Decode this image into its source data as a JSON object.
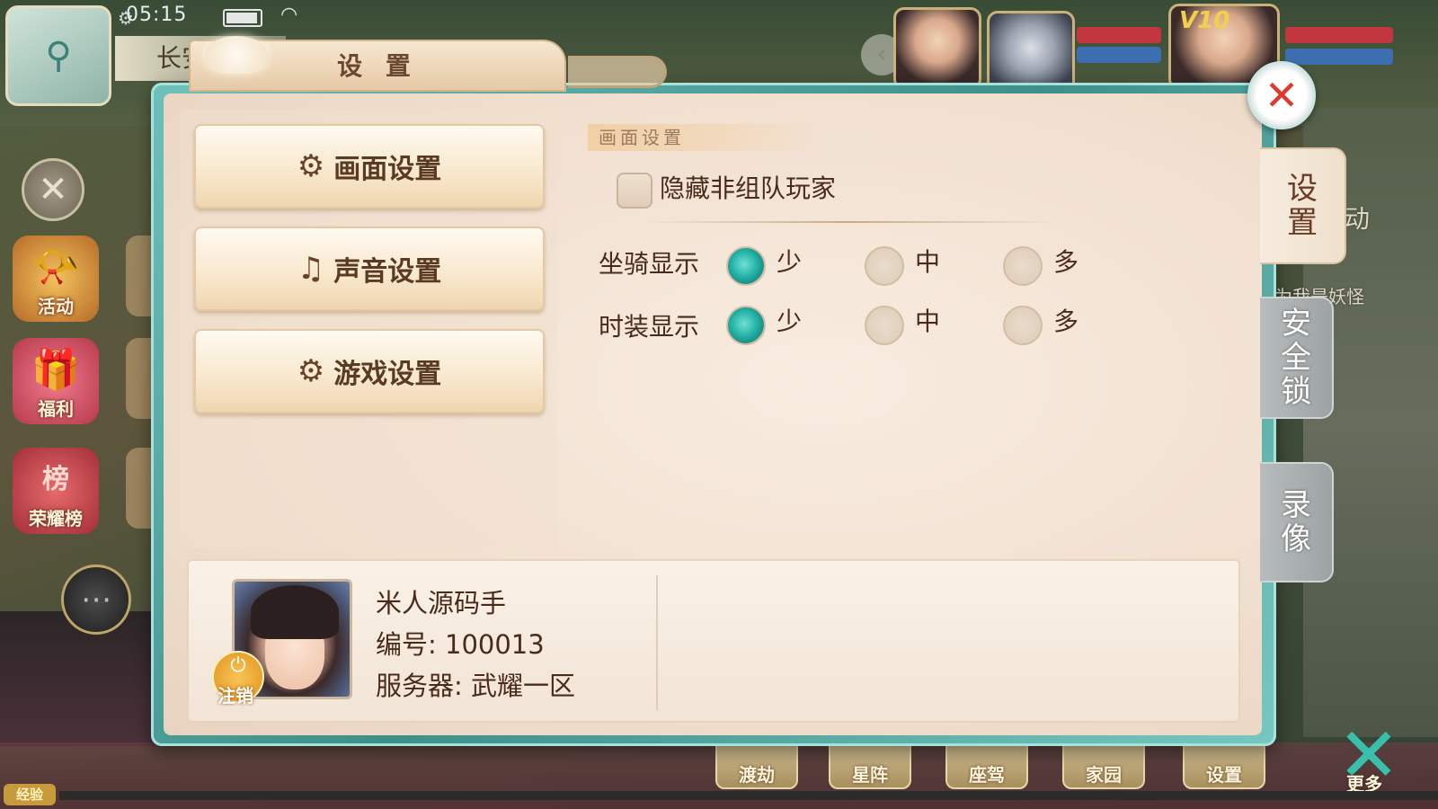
{
  "status": {
    "time": "05:15",
    "location": "长安城"
  },
  "side_icons": [
    {
      "label": "活动"
    },
    {
      "label": "福利"
    },
    {
      "label": "荣耀榜",
      "badge": "榜"
    }
  ],
  "right_bg_text": {
    "top": "动",
    "middle": "为我是妖怪"
  },
  "vip_level": "V10",
  "bottom_menu": [
    "渡劫",
    "星阵",
    "座驾",
    "家园",
    "设置"
  ],
  "more_label": "更多",
  "exp_label": "经验",
  "dialog": {
    "title": "设 置",
    "menu": [
      {
        "label": "画面设置",
        "icon": "⚙"
      },
      {
        "label": "声音设置",
        "icon": "♫"
      },
      {
        "label": "游戏设置",
        "icon": "⚙"
      }
    ],
    "section_title": "画面设置",
    "hide_players_label": "隐藏非组队玩家",
    "hide_players_checked": false,
    "rows": [
      {
        "label": "坐骑显示",
        "options": [
          "少",
          "中",
          "多"
        ],
        "selected": 0
      },
      {
        "label": "时装显示",
        "options": [
          "少",
          "中",
          "多"
        ],
        "selected": 0
      }
    ],
    "tabs": [
      {
        "label": "设置",
        "active": true
      },
      {
        "label": "安全锁",
        "active": false
      },
      {
        "label": "录像",
        "active": false
      }
    ],
    "close_icon": "✕"
  },
  "profile": {
    "name": "米人源码手",
    "id_text": "编号: 100013",
    "server_text": "服务器: 武耀一区",
    "logout_label": "注销"
  },
  "colors": {
    "frame_teal": "#3e8f8a",
    "radio_selected": "#25b3a8",
    "close_red": "#e03a2d",
    "text_brown": "#4a2a1a"
  }
}
